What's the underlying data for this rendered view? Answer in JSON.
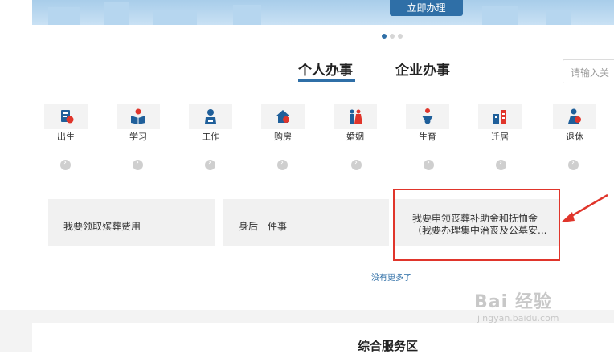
{
  "banner": {
    "button_label": "立即办理"
  },
  "tabs": [
    {
      "label": "个人办事",
      "active": true
    },
    {
      "label": "企业办事",
      "active": false
    }
  ],
  "search": {
    "placeholder": "请输入关"
  },
  "categories": [
    {
      "label": "出生",
      "icon": "birth-icon"
    },
    {
      "label": "学习",
      "icon": "study-icon"
    },
    {
      "label": "工作",
      "icon": "work-icon"
    },
    {
      "label": "购房",
      "icon": "house-icon"
    },
    {
      "label": "婚姻",
      "icon": "marriage-icon"
    },
    {
      "label": "生育",
      "icon": "baby-icon"
    },
    {
      "label": "迁居",
      "icon": "relocate-icon"
    },
    {
      "label": "退休",
      "icon": "retire-icon"
    }
  ],
  "cards": [
    {
      "line1": "我要领取殡葬费用",
      "line2": ""
    },
    {
      "line1": "身后一件事",
      "line2": ""
    },
    {
      "line1": "我要申领丧葬补助金和抚恤金",
      "line2": "（我要办理集中治丧及公墓安..."
    }
  ],
  "no_more_text": "没有更多了",
  "section_title": "综合服务区",
  "watermark": {
    "line1": "Bai 经验",
    "line2": "jingyan.baidu.com"
  },
  "colors": {
    "accent": "#2f6fa7",
    "highlight": "#e0352b",
    "icon_blue": "#1f5f9a",
    "icon_red": "#e0352b"
  }
}
